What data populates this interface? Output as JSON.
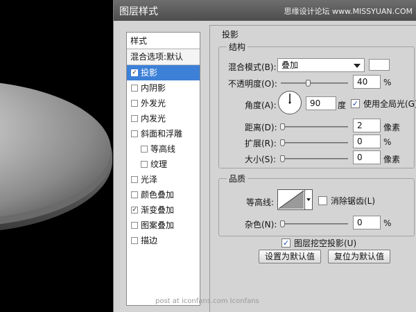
{
  "dialog": {
    "title": "图层样式",
    "watermark": "思缘设计论坛 www.MISSYUAN.COM"
  },
  "style_list": {
    "header": "样式",
    "blend_options": "混合选项:默认",
    "items": [
      {
        "label": "投影",
        "checked": true,
        "active": true,
        "indent": false
      },
      {
        "label": "内阴影",
        "checked": false,
        "active": false,
        "indent": false
      },
      {
        "label": "外发光",
        "checked": false,
        "active": false,
        "indent": false
      },
      {
        "label": "内发光",
        "checked": false,
        "active": false,
        "indent": false
      },
      {
        "label": "斜面和浮雕",
        "checked": false,
        "active": false,
        "indent": false
      },
      {
        "label": "等高线",
        "checked": false,
        "active": false,
        "indent": true
      },
      {
        "label": "纹理",
        "checked": false,
        "active": false,
        "indent": true
      },
      {
        "label": "光泽",
        "checked": false,
        "active": false,
        "indent": false
      },
      {
        "label": "颜色叠加",
        "checked": false,
        "active": false,
        "indent": false
      },
      {
        "label": "渐变叠加",
        "checked": true,
        "active": false,
        "indent": false
      },
      {
        "label": "图案叠加",
        "checked": false,
        "active": false,
        "indent": false
      },
      {
        "label": "描边",
        "checked": false,
        "active": false,
        "indent": false
      }
    ]
  },
  "drop_shadow": {
    "section_title": "投影",
    "structure": {
      "title": "结构",
      "blend_mode_label": "混合模式(B):",
      "blend_mode_value": "叠加",
      "opacity_label": "不透明度(O):",
      "opacity_value": "40",
      "opacity_unit": "%",
      "opacity_level": 40,
      "angle_label": "角度(A):",
      "angle_value": "90",
      "angle_unit": "度",
      "global_light_label": "使用全局光(G)",
      "global_light_checked": true,
      "distance_label": "距离(D):",
      "distance_value": "2",
      "distance_unit": "像素",
      "spread_label": "扩展(R):",
      "spread_value": "0",
      "spread_unit": "%",
      "size_label": "大小(S):",
      "size_value": "0",
      "size_unit": "像素"
    },
    "quality": {
      "title": "品质",
      "contour_label": "等高线:",
      "anti_alias_label": "消除锯齿(L)",
      "anti_alias_checked": false,
      "noise_label": "杂色(N):",
      "noise_value": "0",
      "noise_unit": "%"
    },
    "knockout_label": "图层挖空投影(U)",
    "knockout_checked": true,
    "make_default_label": "设置为默认值",
    "reset_default_label": "复位为默认值"
  },
  "footer": "post at iconfans.com  Iconfans",
  "colors": {
    "selected_bg": "#3d80d8",
    "dialog_bg": "#d4d4d4",
    "titlebar": "#5a5a5a"
  }
}
